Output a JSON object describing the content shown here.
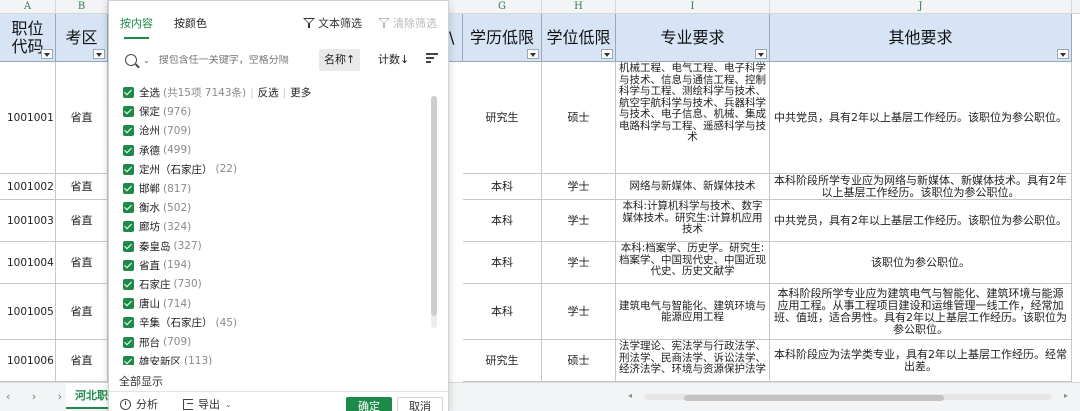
{
  "columns": {
    "A": "A",
    "B": "B",
    "G": "G",
    "H": "H",
    "I": "I",
    "J": "J"
  },
  "headers": {
    "code": "职位代码",
    "district": "考区",
    "partial": "\\",
    "education": "学历低限",
    "degree": "学位低限",
    "major": "专业要求",
    "other": "其他要求"
  },
  "rows": [
    {
      "code": "1001001",
      "district": "省直",
      "education": "研究生",
      "degree": "硕士",
      "major": "机械工程、电气工程、电子科学与技术、信息与通信工程、控制科学与工程、测绘科学与技术、航空宇航科学与技术、兵器科学与技术、电子信息、机械、集成电路科学与工程、遥感科学与技术",
      "other": "中共党员，具有2年以上基层工作经历。该职位为参公职位。"
    },
    {
      "code": "1001002",
      "district": "省直",
      "education": "本科",
      "degree": "学士",
      "major": "网络与新媒体、新媒体技术",
      "other": "本科阶段所学专业应为网络与新媒体、新媒体技术。具有2年以上基层工作经历。该职位为参公职位。"
    },
    {
      "code": "1001003",
      "district": "省直",
      "education": "本科",
      "degree": "学士",
      "major": "本科:计算机科学与技术、数字媒体技术。研究生:计算机应用技术",
      "other": "中共党员，具有2年以上基层工作经历。该职位为参公职位。"
    },
    {
      "code": "1001004",
      "district": "省直",
      "education": "本科",
      "degree": "学士",
      "major": "本科:档案学、历史学。研究生:档案学、中国现代史、中国近现代史、历史文献学",
      "other": "该职位为参公职位。"
    },
    {
      "code": "1001005",
      "district": "省直",
      "education": "本科",
      "degree": "学士",
      "major": "建筑电气与智能化、建筑环境与能源应用工程",
      "other": "本科阶段所学专业应为建筑电气与智能化、建筑环境与能源应用工程。从事工程项目建设和运维管理一线工作，经常加班、值班，适合男性。具有2年以上基层工作经历。该职位为参公职位。"
    },
    {
      "code": "1001006",
      "district": "省直",
      "education": "研究生",
      "degree": "硕士",
      "major": "法学理论、宪法学与行政法学、刑法学、民商法学、诉讼法学、经济法学、环境与资源保护法学",
      "other": "本科阶段应为法学类专业，具有2年以上基层工作经历。经常出差。"
    }
  ],
  "sheet": {
    "tab_label": "河北职"
  },
  "filter": {
    "tab_content": "按内容",
    "tab_color": "按颜色",
    "text_filter": "文本筛选",
    "clear_filter": "清除筛选",
    "search_placeholder": "搜包含任一关键字，空格分隔",
    "sort_name": "名称↑",
    "sort_count": "计数↓",
    "select_all": "全选",
    "select_all_count": "(共15项 7143条)",
    "invert": "反选",
    "more": "更多",
    "items": [
      {
        "label": "保定",
        "count": "(976)"
      },
      {
        "label": "沧州",
        "count": "(709)"
      },
      {
        "label": "承德",
        "count": "(499)"
      },
      {
        "label": "定州（石家庄）",
        "count": "(22)"
      },
      {
        "label": "邯郸",
        "count": "(817)"
      },
      {
        "label": "衡水",
        "count": "(502)"
      },
      {
        "label": "廊坊",
        "count": "(324)"
      },
      {
        "label": "秦皇岛",
        "count": "(327)"
      },
      {
        "label": "省直",
        "count": "(194)"
      },
      {
        "label": "石家庄",
        "count": "(730)"
      },
      {
        "label": "唐山",
        "count": "(714)"
      },
      {
        "label": "辛集（石家庄）",
        "count": "(45)"
      },
      {
        "label": "邢台",
        "count": "(709)"
      },
      {
        "label": "雄安新区",
        "count": "(113)"
      }
    ],
    "show_all": "全部显示",
    "analyze": "分析",
    "export": "导出",
    "ok": "确定",
    "cancel": "取消"
  },
  "colors": {
    "accent": "#1e8a4a",
    "header_bg": "#d6e4f5"
  }
}
